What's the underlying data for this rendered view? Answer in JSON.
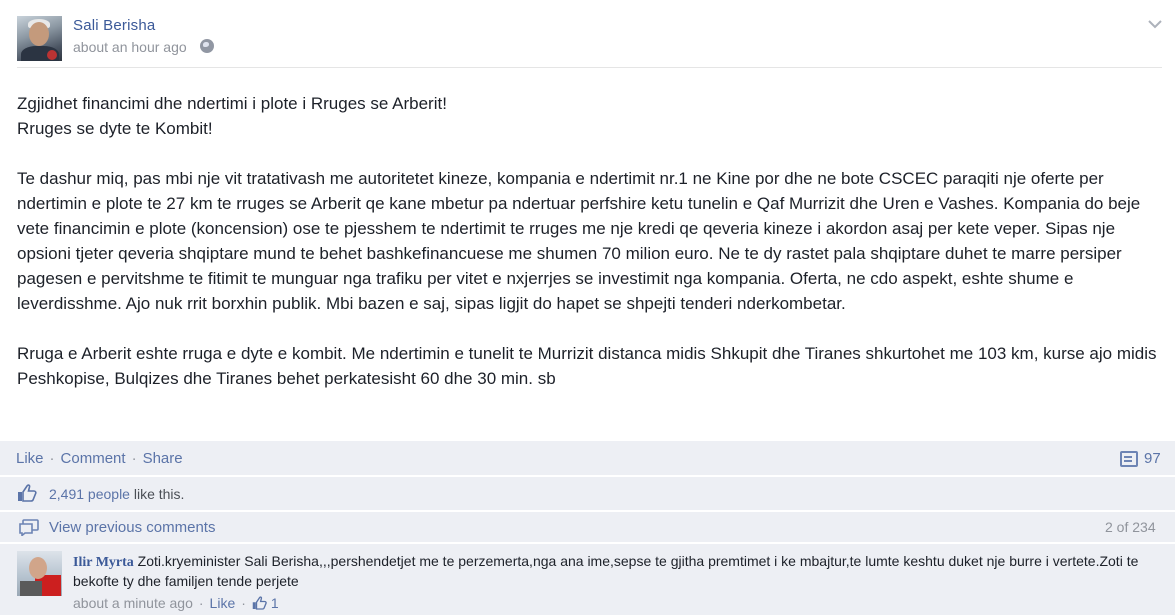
{
  "post": {
    "author": "Sali Berisha",
    "time": "about an hour ago",
    "body": {
      "line1": "Zgjidhet financimi dhe ndertimi i plote i Rruges se Arberit!",
      "line2": "Rruges se dyte te Kombit!",
      "para2": "Te dashur miq, pas mbi nje vit tratativash me autoritetet kineze, kompania e ndertimit nr.1 ne Kine por dhe ne bote CSCEC paraqiti nje oferte per ndertimin e plote te 27 km te rruges se Arberit qe kane mbetur pa ndertuar perfshire ketu tunelin e Qaf Murrizit dhe Uren e Vashes. Kompania do beje vete financimin e plote (koncension) ose te pjesshem te ndertimit te rruges me nje kredi qe qeveria kineze i akordon asaj per kete veper. Sipas nje opsioni tjeter qeveria shqiptare mund te behet bashkefinancuese me shumen 70 milion euro. Ne te dy rastet pala shqiptare duhet te marre persiper pagesen e pervitshme te fitimit te munguar nga trafiku per vitet e nxjerrjes se investimit nga kompania. Oferta, ne cdo aspekt, eshte shume e leverdisshme. Ajo nuk rrit borxhin publik. Mbi bazen e saj, sipas ligjit do hapet se shpejti tenderi nderkombetar.",
      "para3": "Rruga e Arberit eshte rruga e dyte e kombit. Me ndertimin e tunelit te Murrizit distanca midis Shkupit dhe Tiranes shkurtohet me 103 km, kurse ajo midis Peshkopise, Bulqizes dhe Tiranes behet perkatesisht 60 dhe 30 min. sb"
    }
  },
  "actions": {
    "like": "Like",
    "comment": "Comment",
    "share": "Share",
    "sep": "·",
    "comment_count": "97"
  },
  "likes": {
    "count_text": "2,491 people",
    "suffix": " like this."
  },
  "comments_nav": {
    "view_previous": "View previous comments",
    "pager": "2 of 234"
  },
  "comment": {
    "author": "Ilir Myrta",
    "text": "Zoti.kryeminister Sali Berisha,,,pershendetjet me te perzemerta,nga ana ime,sepse te gjitha premtimet i ke mbajtur,te lumte keshtu duket nje burre i vertete.Zoti te bekofte ty dhe familjen tende perjete",
    "time": "about a minute ago",
    "sep": "·",
    "like_label": "Like",
    "like_count": "1"
  },
  "colors": {
    "link": "#3b5998",
    "panel_bg": "#edeff4",
    "muted": "#90949c"
  },
  "icons": [
    "globe-icon",
    "chevron-down-icon",
    "comment-icon",
    "thumb-up-icon",
    "view-comments-icon"
  ]
}
